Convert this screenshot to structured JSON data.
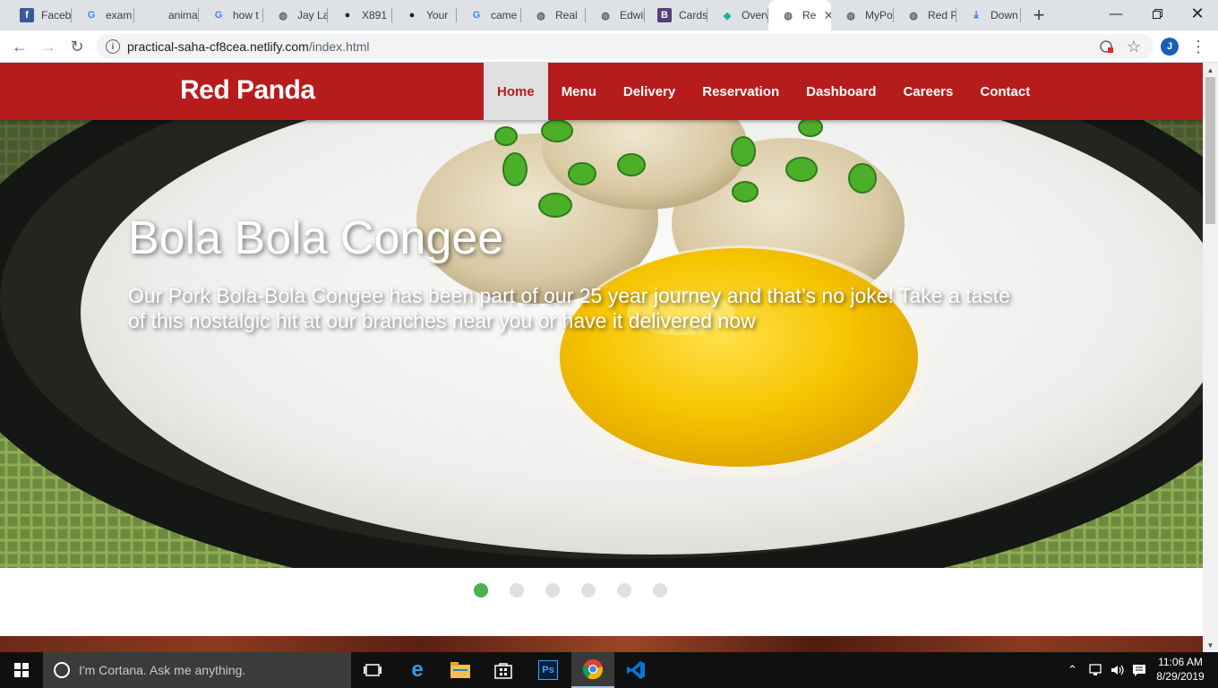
{
  "browser": {
    "tabs": [
      {
        "label": "Faceb",
        "icon": "facebook-icon",
        "fav_bg": "#3b5998",
        "fav_fg": "#fff",
        "fav_glyph": "f"
      },
      {
        "label": "exam",
        "icon": "google-icon",
        "fav_bg": "transparent",
        "fav_fg": "#4285f4",
        "fav_glyph": "G"
      },
      {
        "label": "anima",
        "icon": "blank-page-icon",
        "fav_bg": "transparent",
        "fav_fg": "#5f6368",
        "fav_glyph": ""
      },
      {
        "label": "how t",
        "icon": "google-icon",
        "fav_bg": "transparent",
        "fav_fg": "#4285f4",
        "fav_glyph": "G"
      },
      {
        "label": "Jay La",
        "icon": "globe-icon",
        "fav_bg": "transparent",
        "fav_fg": "#5f6368",
        "fav_glyph": "◍"
      },
      {
        "label": "X891",
        "icon": "github-icon",
        "fav_bg": "transparent",
        "fav_fg": "#202124",
        "fav_glyph": "●"
      },
      {
        "label": "Your",
        "icon": "github-icon",
        "fav_bg": "transparent",
        "fav_fg": "#202124",
        "fav_glyph": "●"
      },
      {
        "label": "came",
        "icon": "google-icon",
        "fav_bg": "transparent",
        "fav_fg": "#4285f4",
        "fav_glyph": "G"
      },
      {
        "label": "Real",
        "icon": "globe-icon",
        "fav_bg": "transparent",
        "fav_fg": "#5f6368",
        "fav_glyph": "◍"
      },
      {
        "label": "Edwil",
        "icon": "globe-icon",
        "fav_bg": "transparent",
        "fav_fg": "#5f6368",
        "fav_glyph": "◍"
      },
      {
        "label": "Cards",
        "icon": "bootstrap-icon",
        "fav_bg": "#563d7c",
        "fav_fg": "#fff",
        "fav_glyph": "B"
      },
      {
        "label": "Overv",
        "icon": "diamond-icon",
        "fav_bg": "transparent",
        "fav_fg": "#16b39d",
        "fav_glyph": "◆"
      },
      {
        "label": "Re",
        "icon": "globe-icon",
        "fav_bg": "transparent",
        "fav_fg": "#5f6368",
        "fav_glyph": "◍",
        "active": true
      },
      {
        "label": "MyPo",
        "icon": "globe-icon",
        "fav_bg": "transparent",
        "fav_fg": "#5f6368",
        "fav_glyph": "◍"
      },
      {
        "label": "Red P",
        "icon": "globe-icon",
        "fav_bg": "transparent",
        "fav_fg": "#5f6368",
        "fav_glyph": "◍"
      },
      {
        "label": "Down",
        "icon": "download-icon",
        "fav_bg": "transparent",
        "fav_fg": "#1a73e8",
        "fav_glyph": "⤓"
      }
    ],
    "url_host": "practical-saha-cf8cea.netlify.com",
    "url_path": "/index.html",
    "profile_initial": "J"
  },
  "site": {
    "brand": "Red Panda",
    "nav": [
      "Home",
      "Menu",
      "Delivery",
      "Reservation",
      "Dashboard",
      "Careers",
      "Contact"
    ],
    "active_nav": "Home",
    "accent_color": "#b71c1c"
  },
  "hero": {
    "title": "Bola Bola Congee",
    "description": "Our Pork Bola-Bola Congee has been part of our 25 year journey and that’s no joke! Take a taste of this nostalgic hit at our branches near you or have it delivered now",
    "slide_count": 6,
    "active_slide": 1,
    "indicator_active_color": "#4caf50"
  },
  "taskbar": {
    "search_placeholder": "I'm Cortana. Ask me anything.",
    "time": "11:06 AM",
    "date": "8/29/2019"
  }
}
